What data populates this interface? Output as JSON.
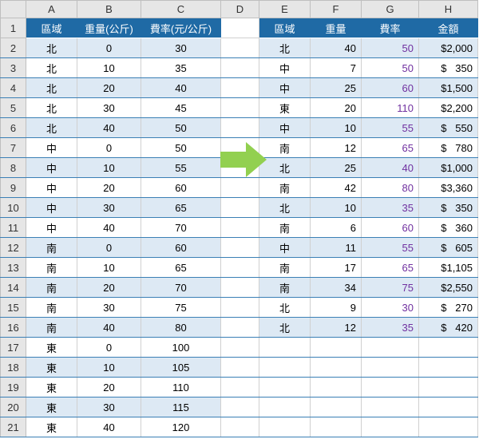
{
  "columns": [
    "A",
    "B",
    "C",
    "D",
    "E",
    "F",
    "G",
    "H"
  ],
  "rowNums": [
    "1",
    "2",
    "3",
    "4",
    "5",
    "6",
    "7",
    "8",
    "9",
    "10",
    "11",
    "12",
    "13",
    "14",
    "15",
    "16",
    "17",
    "18",
    "19",
    "20",
    "21"
  ],
  "left": {
    "headers": {
      "region": "區域",
      "weight": "重量(公斤)",
      "rate": "費率(元/公斤)"
    },
    "rows": [
      {
        "r": "北",
        "w": "0",
        "t": "30"
      },
      {
        "r": "北",
        "w": "10",
        "t": "35"
      },
      {
        "r": "北",
        "w": "20",
        "t": "40"
      },
      {
        "r": "北",
        "w": "30",
        "t": "45"
      },
      {
        "r": "北",
        "w": "40",
        "t": "50"
      },
      {
        "r": "中",
        "w": "0",
        "t": "50"
      },
      {
        "r": "中",
        "w": "10",
        "t": "55"
      },
      {
        "r": "中",
        "w": "20",
        "t": "60"
      },
      {
        "r": "中",
        "w": "30",
        "t": "65"
      },
      {
        "r": "中",
        "w": "40",
        "t": "70"
      },
      {
        "r": "南",
        "w": "0",
        "t": "60"
      },
      {
        "r": "南",
        "w": "10",
        "t": "65"
      },
      {
        "r": "南",
        "w": "20",
        "t": "70"
      },
      {
        "r": "南",
        "w": "30",
        "t": "75"
      },
      {
        "r": "南",
        "w": "40",
        "t": "80"
      },
      {
        "r": "東",
        "w": "0",
        "t": "100"
      },
      {
        "r": "東",
        "w": "10",
        "t": "105"
      },
      {
        "r": "東",
        "w": "20",
        "t": "110"
      },
      {
        "r": "東",
        "w": "30",
        "t": "115"
      },
      {
        "r": "東",
        "w": "40",
        "t": "120"
      }
    ]
  },
  "right": {
    "headers": {
      "region": "區域",
      "weight": "重量",
      "rate": "費率",
      "amount": "金額"
    },
    "rows": [
      {
        "r": "北",
        "w": "40",
        "t": "50",
        "a": "$2,000"
      },
      {
        "r": "中",
        "w": "7",
        "t": "50",
        "a": "$   350"
      },
      {
        "r": "中",
        "w": "25",
        "t": "60",
        "a": "$1,500"
      },
      {
        "r": "東",
        "w": "20",
        "t": "110",
        "a": "$2,200"
      },
      {
        "r": "中",
        "w": "10",
        "t": "55",
        "a": "$   550"
      },
      {
        "r": "南",
        "w": "12",
        "t": "65",
        "a": "$   780"
      },
      {
        "r": "北",
        "w": "25",
        "t": "40",
        "a": "$1,000"
      },
      {
        "r": "南",
        "w": "42",
        "t": "80",
        "a": "$3,360"
      },
      {
        "r": "北",
        "w": "10",
        "t": "35",
        "a": "$   350"
      },
      {
        "r": "南",
        "w": "6",
        "t": "60",
        "a": "$   360"
      },
      {
        "r": "中",
        "w": "11",
        "t": "55",
        "a": "$   605"
      },
      {
        "r": "南",
        "w": "17",
        "t": "65",
        "a": "$1,105"
      },
      {
        "r": "南",
        "w": "34",
        "t": "75",
        "a": "$2,550"
      },
      {
        "r": "北",
        "w": "9",
        "t": "30",
        "a": "$   270"
      },
      {
        "r": "北",
        "w": "12",
        "t": "35",
        "a": "$   420"
      }
    ]
  },
  "chart_data": {
    "type": "table",
    "left_table": {
      "columns": [
        "區域",
        "重量(公斤)",
        "費率(元/公斤)"
      ],
      "data": [
        [
          "北",
          0,
          30
        ],
        [
          "北",
          10,
          35
        ],
        [
          "北",
          20,
          40
        ],
        [
          "北",
          30,
          45
        ],
        [
          "北",
          40,
          50
        ],
        [
          "中",
          0,
          50
        ],
        [
          "中",
          10,
          55
        ],
        [
          "中",
          20,
          60
        ],
        [
          "中",
          30,
          65
        ],
        [
          "中",
          40,
          70
        ],
        [
          "南",
          0,
          60
        ],
        [
          "南",
          10,
          65
        ],
        [
          "南",
          20,
          70
        ],
        [
          "南",
          30,
          75
        ],
        [
          "南",
          40,
          80
        ],
        [
          "東",
          0,
          100
        ],
        [
          "東",
          10,
          105
        ],
        [
          "東",
          20,
          110
        ],
        [
          "東",
          30,
          115
        ],
        [
          "東",
          40,
          120
        ]
      ]
    },
    "right_table": {
      "columns": [
        "區域",
        "重量",
        "費率",
        "金額"
      ],
      "data": [
        [
          "北",
          40,
          50,
          2000
        ],
        [
          "中",
          7,
          50,
          350
        ],
        [
          "中",
          25,
          60,
          1500
        ],
        [
          "東",
          20,
          110,
          2200
        ],
        [
          "中",
          10,
          55,
          550
        ],
        [
          "南",
          12,
          65,
          780
        ],
        [
          "北",
          25,
          40,
          1000
        ],
        [
          "南",
          42,
          80,
          3360
        ],
        [
          "北",
          10,
          35,
          350
        ],
        [
          "南",
          6,
          60,
          360
        ],
        [
          "中",
          11,
          55,
          605
        ],
        [
          "南",
          17,
          65,
          1105
        ],
        [
          "南",
          34,
          75,
          2550
        ],
        [
          "北",
          9,
          30,
          270
        ],
        [
          "北",
          12,
          35,
          420
        ]
      ]
    }
  }
}
